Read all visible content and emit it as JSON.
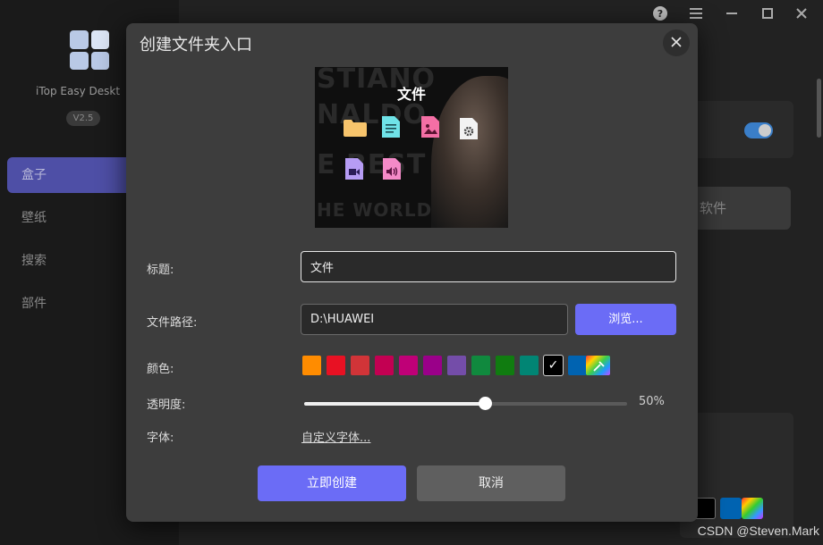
{
  "app": {
    "name": "iTop Easy Deskt",
    "version": "V2.5",
    "nav": [
      {
        "label": "盒子",
        "active": true
      },
      {
        "label": "壁纸",
        "active": false
      },
      {
        "label": "搜索",
        "active": false
      },
      {
        "label": "部件",
        "active": false
      }
    ],
    "bg_button_label": "软件",
    "window_controls": [
      "help-icon",
      "menu-icon",
      "minimize-icon",
      "maximize-icon",
      "close-icon"
    ]
  },
  "dialog": {
    "title": "创建文件夹入口",
    "preview": {
      "title": "文件",
      "background_text": [
        "STIANO",
        "NALDO",
        "E BEST",
        "HE WORLD"
      ],
      "icons": [
        "folder-icon",
        "document-icon",
        "image-file-icon",
        "settings-file-icon",
        "video-file-icon",
        "audio-file-icon"
      ]
    },
    "fields": {
      "title_label": "标题:",
      "title_value": "文件",
      "path_label": "文件路径:",
      "path_value": "D:\\HUAWEI",
      "browse_label": "浏览...",
      "color_label": "颜色:",
      "opacity_label": "透明度:",
      "opacity_percent": 50,
      "opacity_text": "50%",
      "font_label": "字体:",
      "font_link": "自定义字体..."
    },
    "colors": [
      "#ff8c00",
      "#e81123",
      "#d13438",
      "#c30052",
      "#bf0077",
      "#9a0089",
      "#744da9",
      "#10893e",
      "#107c10",
      "#018574",
      "#000000",
      "#0063b1",
      "custom-gradient"
    ],
    "selected_color_index": 10,
    "create_button": "立即创建",
    "cancel_button": "取消"
  },
  "watermark": "CSDN @Steven.Mark"
}
